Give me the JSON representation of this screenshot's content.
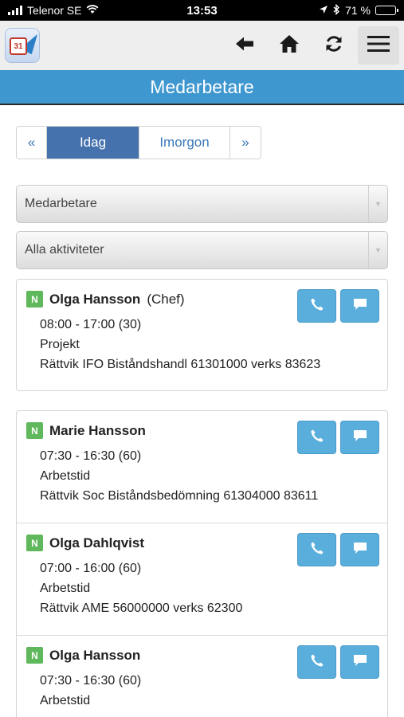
{
  "status_bar": {
    "carrier": "Telenor SE",
    "time": "13:53",
    "battery": "71 %",
    "battery_level": 0.71,
    "icons": [
      "signal-icon",
      "wifi-icon",
      "location-arrow-icon",
      "bluetooth-icon",
      "battery-icon"
    ]
  },
  "toolbar": {
    "logo_text": "31",
    "icons": [
      "back-arrow-icon",
      "home-icon",
      "refresh-icon",
      "hamburger-menu-icon"
    ]
  },
  "page": {
    "title": "Medarbetare"
  },
  "pager": {
    "prev": "«",
    "today": "Idag",
    "tomorrow": "Imorgon",
    "next": "»"
  },
  "filters": {
    "employee_select": "Medarbetare",
    "activity_select": "Alla aktiviteter"
  },
  "entries": [
    {
      "badge": "N",
      "name": "Olga Hansson",
      "role": "(Chef)",
      "time": "08:00 - 17:00 (30)",
      "activity": "Projekt",
      "location": "Rättvik IFO Biståndshandl 61301000 verks 83623"
    },
    {
      "badge": "N",
      "name": "Marie Hansson",
      "role": "",
      "time": "07:30 - 16:30 (60)",
      "activity": "Arbetstid",
      "location": "Rättvik Soc Biståndsbedömning 61304000 83611"
    },
    {
      "badge": "N",
      "name": "Olga Dahlqvist",
      "role": "",
      "time": "07:00 - 16:00 (60)",
      "activity": "Arbetstid",
      "location": "Rättvik AME 56000000 verks 62300"
    },
    {
      "badge": "N",
      "name": "Olga Hansson",
      "role": "",
      "time": "07:30 - 16:30 (60)",
      "activity": "Arbetstid",
      "location": ""
    }
  ],
  "colors": {
    "title_band": "#3f97cf",
    "pager_active": "#4572ad",
    "action_button": "#5aaedc",
    "badge": "#5fb85b"
  }
}
